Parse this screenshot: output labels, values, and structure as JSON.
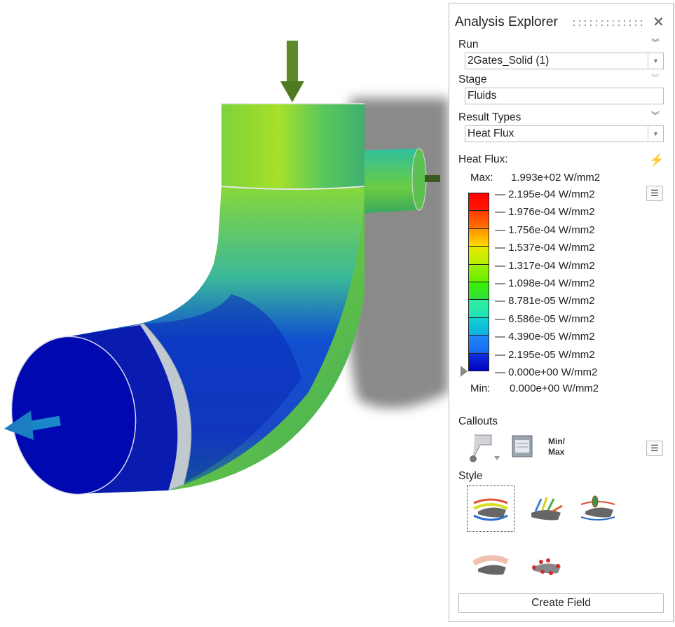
{
  "panel": {
    "title": "Analysis Explorer",
    "close": "✕"
  },
  "run": {
    "label": "Run",
    "value": "2Gates_Solid (1)"
  },
  "stage": {
    "label": "Stage",
    "value": "Fluids"
  },
  "result_types": {
    "label": "Result Types",
    "value": "Heat Flux"
  },
  "legend": {
    "title": "Heat Flux:",
    "max_label": "Max:",
    "max_value": "1.993e+02 W/mm2",
    "min_label": "Min:",
    "min_value": "0.000e+00 W/mm2",
    "ticks": [
      "— 2.195e-04 W/mm2",
      "— 1.976e-04 W/mm2",
      "— 1.756e-04 W/mm2",
      "— 1.537e-04 W/mm2",
      "— 1.317e-04 W/mm2",
      "— 1.098e-04 W/mm2",
      "— 8.781e-05 W/mm2",
      "— 6.586e-05 W/mm2",
      "— 4.390e-05 W/mm2",
      "— 2.195e-05 W/mm2",
      "— 0.000e+00 W/mm2"
    ],
    "bands": [
      [
        "#ff0000",
        "#ff1a00"
      ],
      [
        "#ff3a00",
        "#ff7400"
      ],
      [
        "#ff9400",
        "#ffd800"
      ],
      [
        "#e4e800",
        "#b8f000"
      ],
      [
        "#9cf000",
        "#66ee00"
      ],
      [
        "#3cf000",
        "#30e040"
      ],
      [
        "#30f0a0",
        "#20e0b8"
      ],
      [
        "#10d0d0",
        "#10b0e0"
      ],
      [
        "#2088f8",
        "#1868f0"
      ],
      [
        "#1030e0",
        "#0000c0"
      ]
    ]
  },
  "callouts": {
    "label": "Callouts",
    "minmax_line1": "Min/",
    "minmax_line2": "Max"
  },
  "style": {
    "label": "Style"
  },
  "create_field": "Create Field"
}
